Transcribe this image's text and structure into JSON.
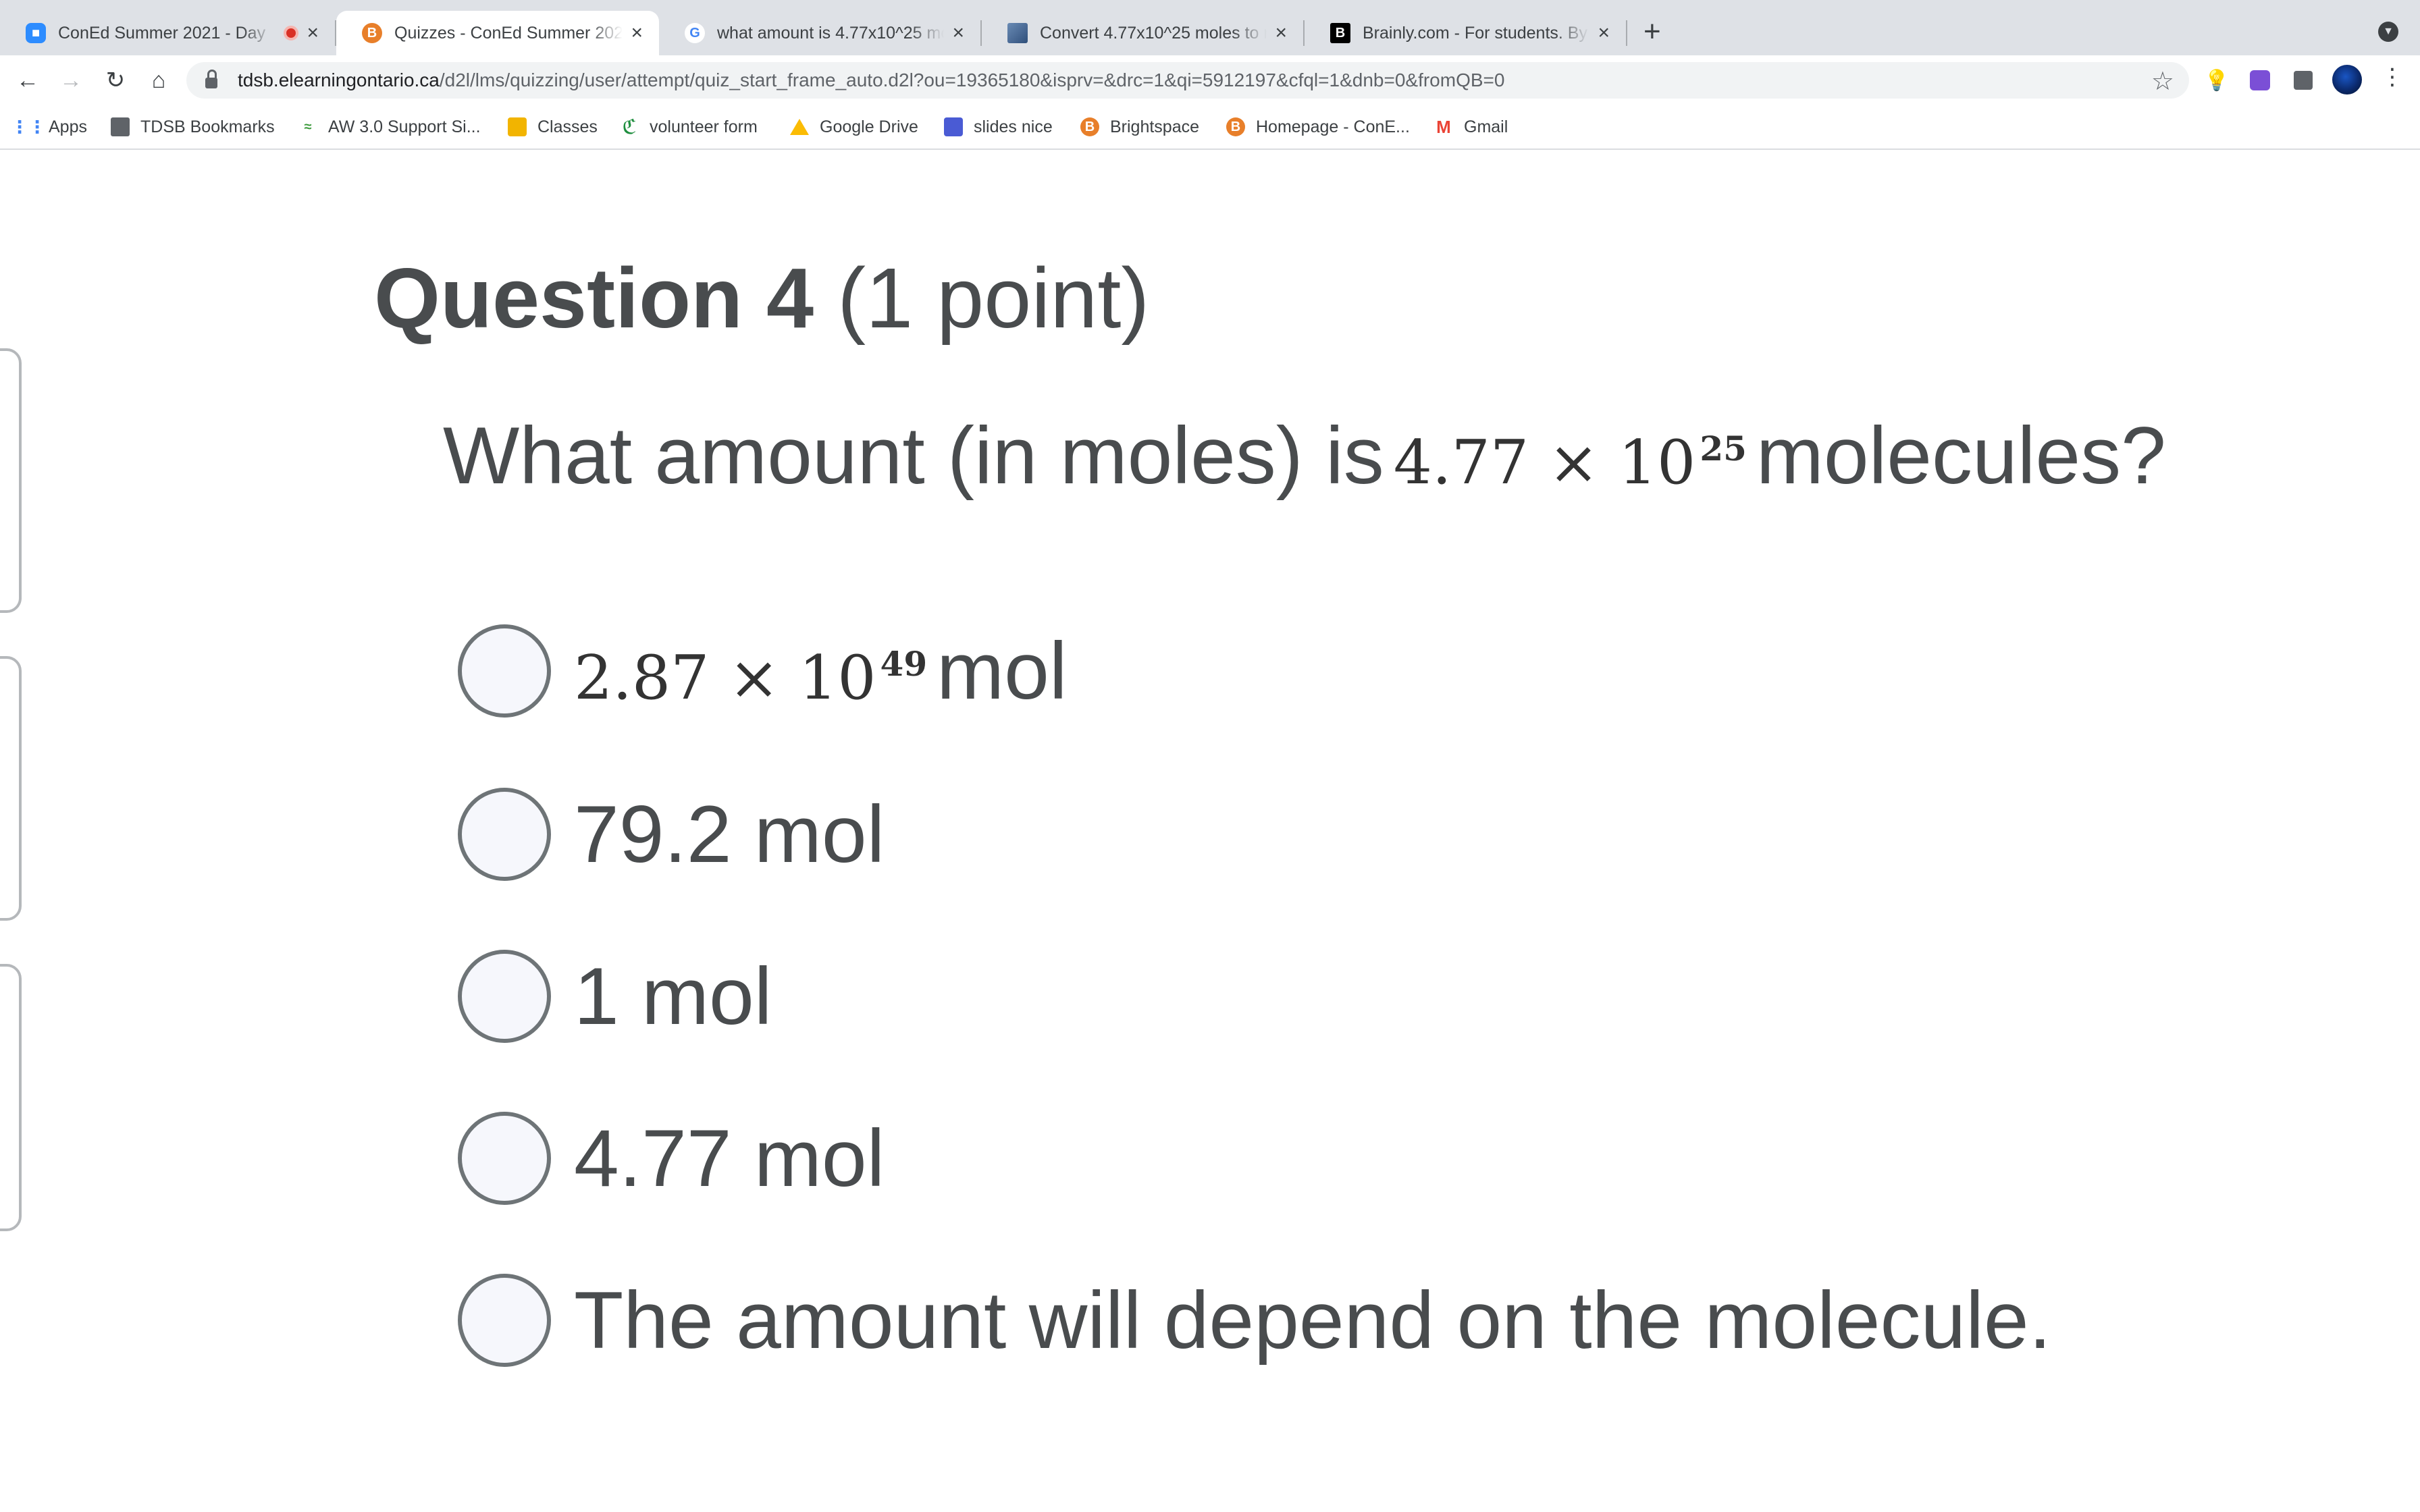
{
  "browser": {
    "tabs": [
      {
        "title": "ConEd Summer 2021 - Day",
        "favicon": "zoom-icon",
        "recording": true
      },
      {
        "title": "Quizzes - ConEd Summer 2021",
        "favicon": "brightspace-icon",
        "active": true
      },
      {
        "title": "what amount is 4.77x10^25 mo",
        "favicon": "google-icon"
      },
      {
        "title": "Convert 4.77x10^25 moles to m",
        "favicon": "convert-site-icon"
      },
      {
        "title": "Brainly.com - For students. By",
        "favicon": "brainly-icon"
      }
    ],
    "url_host": "tdsb.elearningontario.ca",
    "url_path": "/d2l/lms/quizzing/user/attempt/quiz_start_frame_auto.d2l?ou=19365180&isprv=&drc=1&qi=5912197&cfql=1&dnb=0&fromQB=0",
    "bookmarks": [
      {
        "label": "Apps",
        "icon": "apps-grid-icon"
      },
      {
        "label": "TDSB Bookmarks",
        "icon": "folder-icon"
      },
      {
        "label": "AW 3.0 Support Si...",
        "icon": "aw-icon"
      },
      {
        "label": "Classes",
        "icon": "classroom-icon"
      },
      {
        "label": "volunteer form",
        "icon": "volunteer-icon"
      },
      {
        "label": "Google Drive",
        "icon": "google-drive-icon"
      },
      {
        "label": "slides nice",
        "icon": "slides-icon"
      },
      {
        "label": "Brightspace",
        "icon": "brightspace-icon"
      },
      {
        "label": "Homepage - ConE...",
        "icon": "brightspace-icon"
      },
      {
        "label": "Gmail",
        "icon": "gmail-icon"
      }
    ]
  },
  "question": {
    "number_label": "Question 4",
    "points_label": "(1 point)",
    "prompt_before": "What amount (in moles) is",
    "prompt_value_base": "4.77 × 10",
    "prompt_value_exp": "25",
    "prompt_after": "molecules?",
    "options": [
      {
        "sci_base": "2.87 × 10",
        "sci_exp": "49",
        "text": "mol"
      },
      {
        "text": "79.2 mol"
      },
      {
        "text": "1 mol"
      },
      {
        "text": "4.77 mol"
      },
      {
        "text": "The amount will depend on the molecule."
      }
    ]
  }
}
